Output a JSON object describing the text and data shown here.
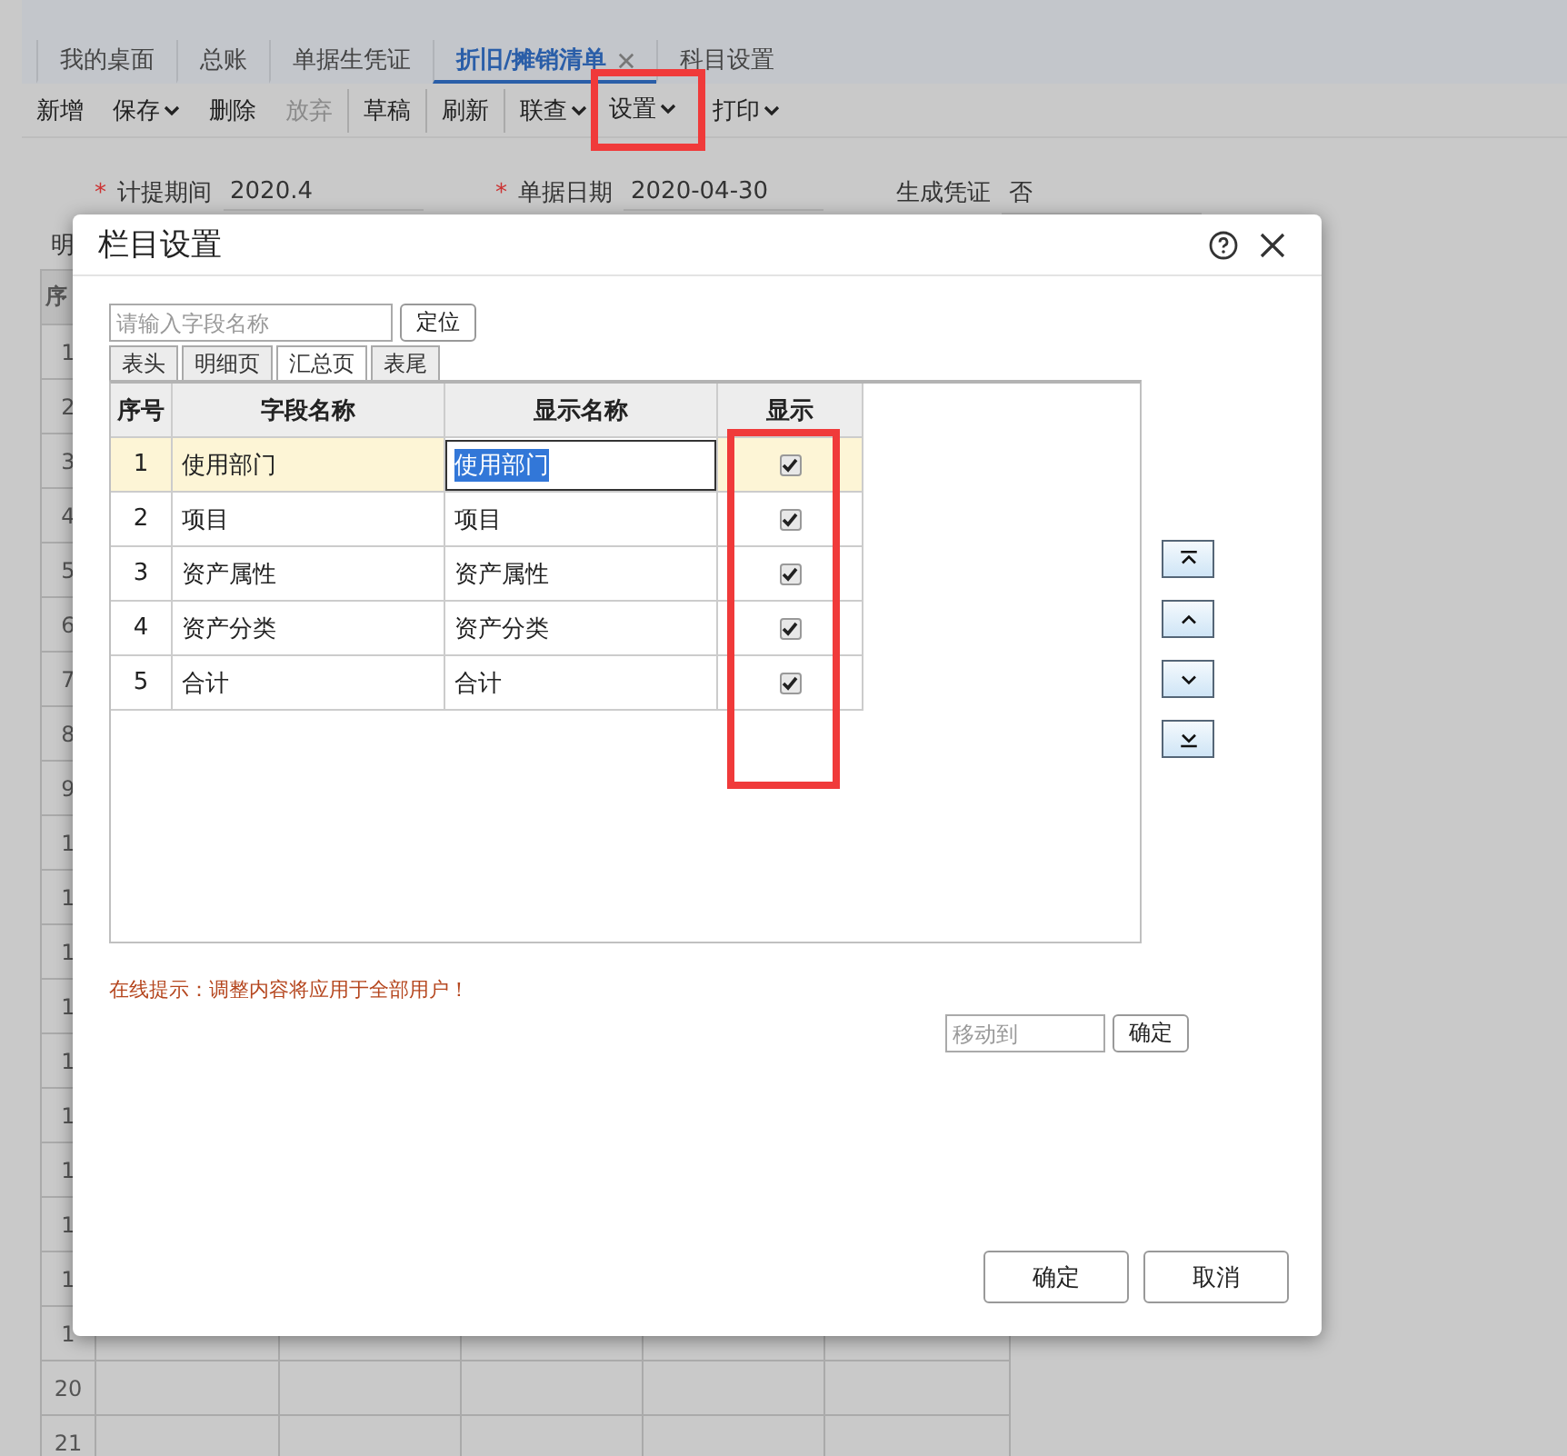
{
  "tabs": [
    {
      "label": "我的桌面",
      "selected": false,
      "closable": false
    },
    {
      "label": "总账",
      "selected": false,
      "closable": false
    },
    {
      "label": "单据生凭证",
      "selected": false,
      "closable": false
    },
    {
      "label": "折旧/摊销清单",
      "selected": true,
      "closable": true
    },
    {
      "label": "科目设置",
      "selected": false,
      "closable": false
    }
  ],
  "toolbar": [
    {
      "label": "新增",
      "dropdown": false,
      "disabled": false,
      "separator_before": false,
      "highlighted": false
    },
    {
      "label": "保存",
      "dropdown": true,
      "disabled": false,
      "separator_before": false,
      "highlighted": false
    },
    {
      "label": "删除",
      "dropdown": false,
      "disabled": false,
      "separator_before": false,
      "highlighted": false
    },
    {
      "label": "放弃",
      "dropdown": false,
      "disabled": true,
      "separator_before": false,
      "highlighted": false
    },
    {
      "label": "草稿",
      "dropdown": false,
      "disabled": false,
      "separator_before": true,
      "highlighted": false
    },
    {
      "label": "刷新",
      "dropdown": false,
      "disabled": false,
      "separator_before": true,
      "highlighted": false
    },
    {
      "label": "联查",
      "dropdown": true,
      "disabled": false,
      "separator_before": true,
      "highlighted": false
    },
    {
      "label": "设置",
      "dropdown": true,
      "disabled": false,
      "separator_before": false,
      "highlighted": true
    },
    {
      "label": "打印",
      "dropdown": true,
      "disabled": false,
      "separator_before": false,
      "highlighted": false
    }
  ],
  "form": [
    {
      "marker": "*",
      "label": "计提期间",
      "value": "2020.4"
    },
    {
      "marker": "*",
      "label": "单据日期",
      "value": "2020-04-30"
    },
    {
      "label": "生成凭证",
      "value": "否"
    }
  ],
  "section_label": "明",
  "grid": {
    "header": "序",
    "rows": [
      "1",
      "2",
      "3",
      "4",
      "5",
      "6",
      "7",
      "8",
      "9",
      "1",
      "1",
      "1",
      "1",
      "1",
      "1",
      "1",
      "1",
      "1",
      "1",
      "20",
      "21"
    ]
  },
  "dialog": {
    "title": "栏目设置",
    "search": {
      "placeholder": "请输入字段名称"
    },
    "locate_button": "定位",
    "tabs": [
      {
        "label": "表头",
        "selected": false
      },
      {
        "label": "明细页",
        "selected": false
      },
      {
        "label": "汇总页",
        "selected": true
      },
      {
        "label": "表尾",
        "selected": false
      }
    ],
    "columns": [
      "序号",
      "字段名称",
      "显示名称",
      "显示"
    ],
    "show_column_highlighted": true,
    "rows": [
      {
        "index": "1",
        "field": "使用部门",
        "display": "使用部门",
        "shown": true,
        "selected": true
      },
      {
        "index": "2",
        "field": "项目",
        "display": "项目",
        "shown": true,
        "selected": false
      },
      {
        "index": "3",
        "field": "资产属性",
        "display": "资产属性",
        "shown": true,
        "selected": false
      },
      {
        "index": "4",
        "field": "资产分类",
        "display": "资产分类",
        "shown": true,
        "selected": false
      },
      {
        "index": "5",
        "field": "合计",
        "display": "合计",
        "shown": true,
        "selected": false
      }
    ],
    "move_buttons": [
      {
        "kind": "top"
      },
      {
        "kind": "up"
      },
      {
        "kind": "down"
      },
      {
        "kind": "bottom"
      }
    ],
    "hint": "在线提示：调整内容将应用于全部用户！",
    "move_to": {
      "placeholder": "移动到"
    },
    "move_confirm": "确定",
    "buttons": [
      "确定",
      "取消"
    ]
  }
}
